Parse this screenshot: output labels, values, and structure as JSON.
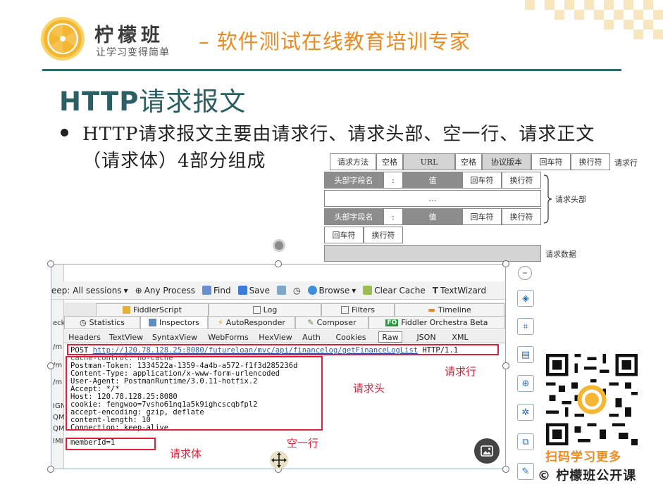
{
  "header": {
    "brand_name": "柠檬班",
    "brand_slogan": "让学习变得简单",
    "tagline": "– 软件测试在线教育培训专家"
  },
  "slide": {
    "title_latin": "HTTP",
    "title_cn": "请求报文",
    "bullet": "HTTP请求报文主要由请求行、请求头部、空一行、请求正文（请求体）4部分组成"
  },
  "diagram": {
    "row1": [
      "请求方法",
      "空格",
      "URL",
      "空格",
      "协议版本",
      "回车符",
      "换行符"
    ],
    "row1_label": "请求行",
    "header_row": [
      "头部字段名",
      ":",
      "值",
      "回车符",
      "换行符"
    ],
    "ellipsis": "…",
    "header_label": "请求头部",
    "blank_row": [
      "回车符",
      "换行符"
    ],
    "body_label": "请求数据"
  },
  "fiddler": {
    "toolbar": {
      "sessions": "eep: All sessions",
      "process": "Any Process",
      "find": "Find",
      "save": "Save",
      "browse": "Browse",
      "clear_cache": "Clear Cache",
      "text_wizard": "TextWizard"
    },
    "tabs_top": [
      "FiddlerScript",
      "Log",
      "Filters",
      "Timeline"
    ],
    "tabs_bottom": [
      "Statistics",
      "Inspectors",
      "AutoResponder",
      "Composer",
      "Fiddler Orchestra Beta"
    ],
    "fo_badge": "FO",
    "subtabs": [
      "Headers",
      "TextView",
      "SyntaxView",
      "WebForms",
      "HexView",
      "Auth",
      "Cookies",
      "Raw",
      "JSON",
      "XML"
    ],
    "left_strip": [
      "eck",
      "/m",
      "/m",
      "/m",
      "IGN",
      "QM",
      "QM",
      "IMI"
    ],
    "raw": {
      "method": "POST",
      "url": "http://120.78.128.25:8080/futureloan/mvc/api/financelog/getFinanceLogList",
      "protocol": "HTTP/1.1",
      "lines": [
        "cache-control: no-cache",
        "Postman-Token: 1334522a-1359-4a4b-a572-f1f3d285236d",
        "Content-Type: application/x-www-form-urlencoded",
        "User-Agent: PostmanRuntime/3.0.11-hotfix.2",
        "Accept: */*",
        "Host: 120.78.128.25:8080",
        "cookie: fengwoo=7vsho61nq1a5k9ighcscqbfpl2",
        "accept-encoding: gzip, deflate",
        "content-length: 10",
        "Connection: keep-alive"
      ],
      "body": "memberId=1"
    },
    "annotations": {
      "request_line": "请求行",
      "request_header": "请求头",
      "blank_line": "空一行",
      "request_body": "请求体"
    }
  },
  "qr_caption": "扫码学习更多",
  "footer_brand": "© 柠檬班公开课",
  "colors": {
    "accent_orange": "#ee8a1e",
    "title_teal": "#2b5f63",
    "annotation_red": "#e0203a"
  }
}
